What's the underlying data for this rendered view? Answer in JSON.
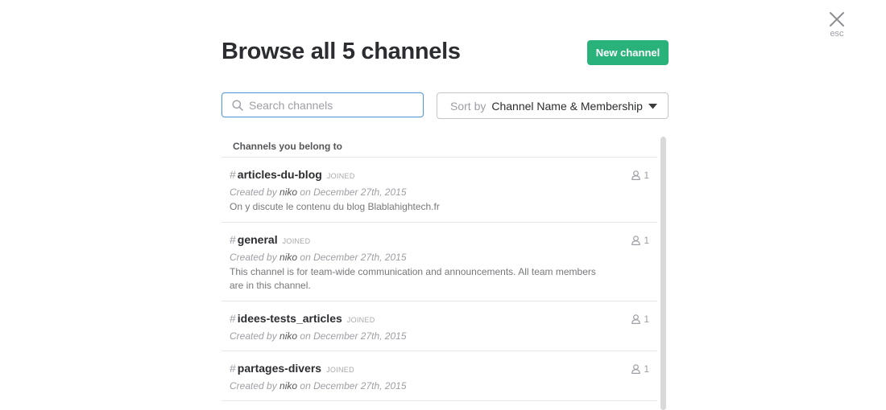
{
  "close": {
    "label": "esc"
  },
  "header": {
    "title": "Browse all 5 channels",
    "new_channel_label": "New channel"
  },
  "search": {
    "placeholder": "Search channels",
    "value": ""
  },
  "sort": {
    "label": "Sort by",
    "value": "Channel Name & Membership"
  },
  "section": {
    "title": "Channels you belong to"
  },
  "channels": [
    {
      "name": "articles-du-blog",
      "status": "JOINED",
      "created_prefix": "Created by",
      "creator": "niko",
      "created_suffix": "on December 27th, 2015",
      "description": "On y discute le contenu du blog Blablahightech.fr",
      "members": "1"
    },
    {
      "name": "general",
      "status": "JOINED",
      "created_prefix": "Created by",
      "creator": "niko",
      "created_suffix": "on December 27th, 2015",
      "description": "This channel is for team-wide communication and announcements. All team members are in this channel.",
      "members": "1"
    },
    {
      "name": "idees-tests_articles",
      "status": "JOINED",
      "created_prefix": "Created by",
      "creator": "niko",
      "created_suffix": "on December 27th, 2015",
      "description": "",
      "members": "1"
    },
    {
      "name": "partages-divers",
      "status": "JOINED",
      "created_prefix": "Created by",
      "creator": "niko",
      "created_suffix": "on December 27th, 2015",
      "description": "",
      "members": "1"
    }
  ],
  "icons": {
    "close": "close-icon",
    "search": "search-icon",
    "sort": "caret-down-icon",
    "members": "user-icon"
  },
  "colors": {
    "primary_button": "#2ab27b",
    "focus_border": "#5b9bd5"
  }
}
